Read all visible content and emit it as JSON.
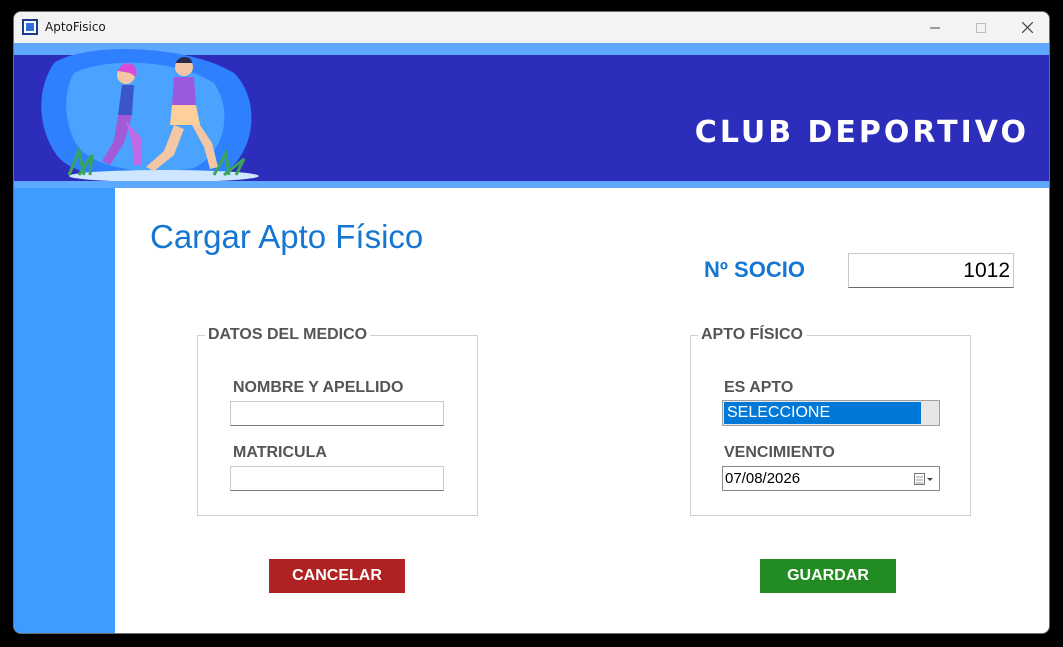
{
  "window": {
    "title": "AptoFisico",
    "app_icon": "app-icon",
    "controls": [
      "minimize-icon",
      "maximize-icon",
      "close-icon"
    ]
  },
  "banner": {
    "title": "CLUB DEPORTIVO",
    "image": "runners-illustration"
  },
  "page": {
    "title": "Cargar Apto Físico",
    "socio_label": "Nº SOCIO",
    "socio_value": "1012"
  },
  "medico_group": {
    "legend": "DATOS DEL MEDICO",
    "nombre_label": "NOMBRE Y APELLIDO",
    "nombre_value": "",
    "matricula_label": "MATRICULA",
    "matricula_value": ""
  },
  "apto_group": {
    "legend": "APTO FÍSICO",
    "es_apto_label": "ES APTO",
    "es_apto_value": "SELECCIONE",
    "vencimiento_label": "VENCIMIENTO",
    "vencimiento_value": "07/08/2026"
  },
  "buttons": {
    "cancel_label": "CANCELAR",
    "save_label": "GUARDAR"
  },
  "colors": {
    "banner": "#2d2dbb",
    "accent_light": "#5ea8ff",
    "sidebar": "#3c9cff",
    "title": "#1677d2",
    "cancel": "#b02222",
    "save": "#228b22",
    "selection": "#0078d7"
  }
}
